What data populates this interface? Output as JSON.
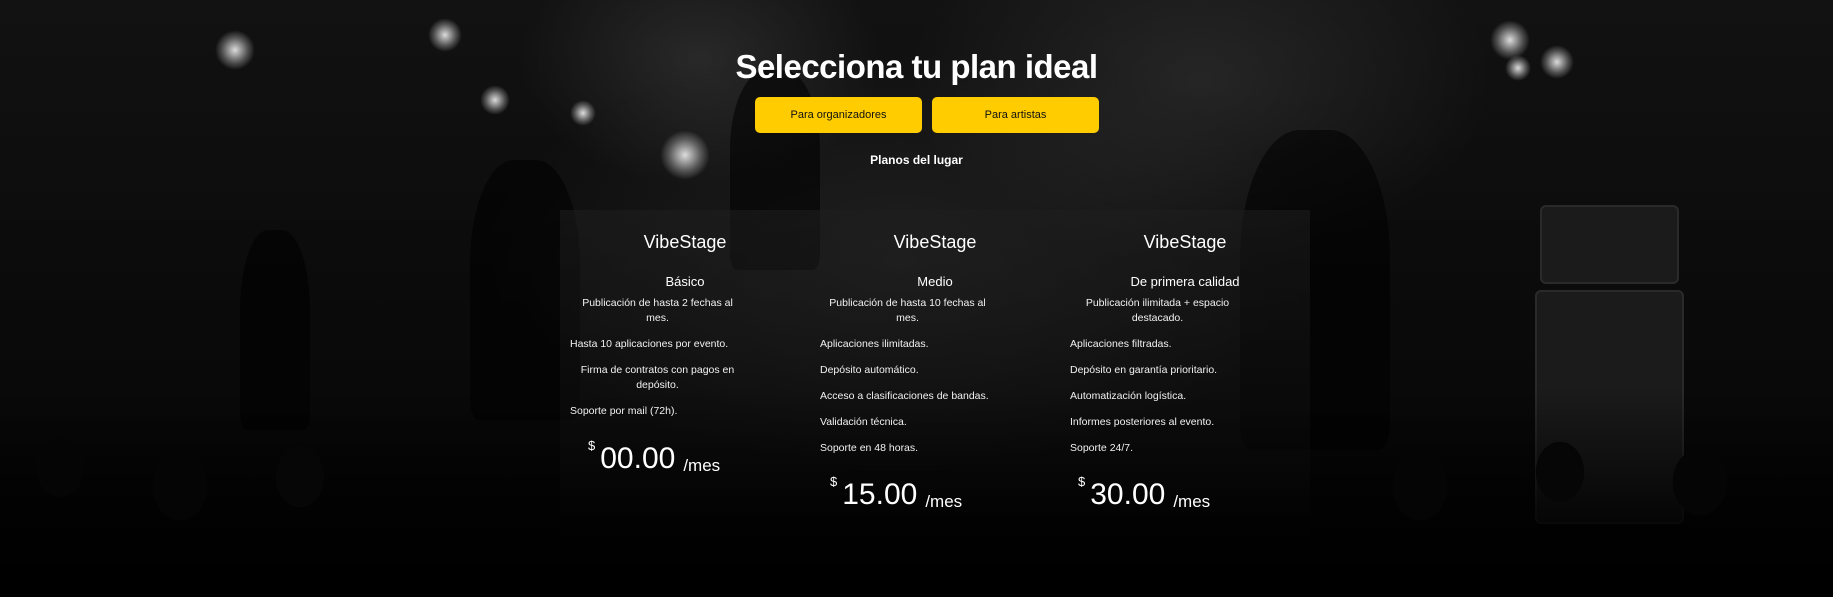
{
  "header": {
    "title": "Selecciona tu plan ideal",
    "tabs": [
      {
        "label": "Para organizadores"
      },
      {
        "label": "Para artistas"
      }
    ],
    "subtitle": "Planos del lugar"
  },
  "plans": [
    {
      "brand": "VibeStage",
      "tier": "Básico",
      "features": [
        "Publicación de hasta 2 fechas al mes.",
        "Hasta 10 aplicaciones por evento.",
        "Firma de contratos con pagos en depósito.",
        "Soporte por mail (72h)."
      ],
      "currency": "$",
      "amount": "00.00",
      "period": "/mes"
    },
    {
      "brand": "VibeStage",
      "tier": "Medio",
      "features": [
        "Publicación de hasta 10 fechas al mes.",
        "Aplicaciones ilimitadas.",
        "Depósito automático.",
        "Acceso a clasificaciones de bandas.",
        "Validación técnica.",
        "Soporte en 48 horas."
      ],
      "currency": "$",
      "amount": "15.00",
      "period": "/mes"
    },
    {
      "brand": "VibeStage",
      "tier": "De primera calidad",
      "features": [
        "Publicación ilimitada + espacio destacado.",
        "Aplicaciones filtradas.",
        "Depósito en garantía prioritario.",
        "Automatización logística.",
        "Informes posteriores al evento.",
        "Soporte 24/7."
      ],
      "currency": "$",
      "amount": "30.00",
      "period": "/mes"
    }
  ],
  "theme": {
    "accent": "#ffcc00",
    "background": "#0a0a0a",
    "text": "#ffffff"
  }
}
